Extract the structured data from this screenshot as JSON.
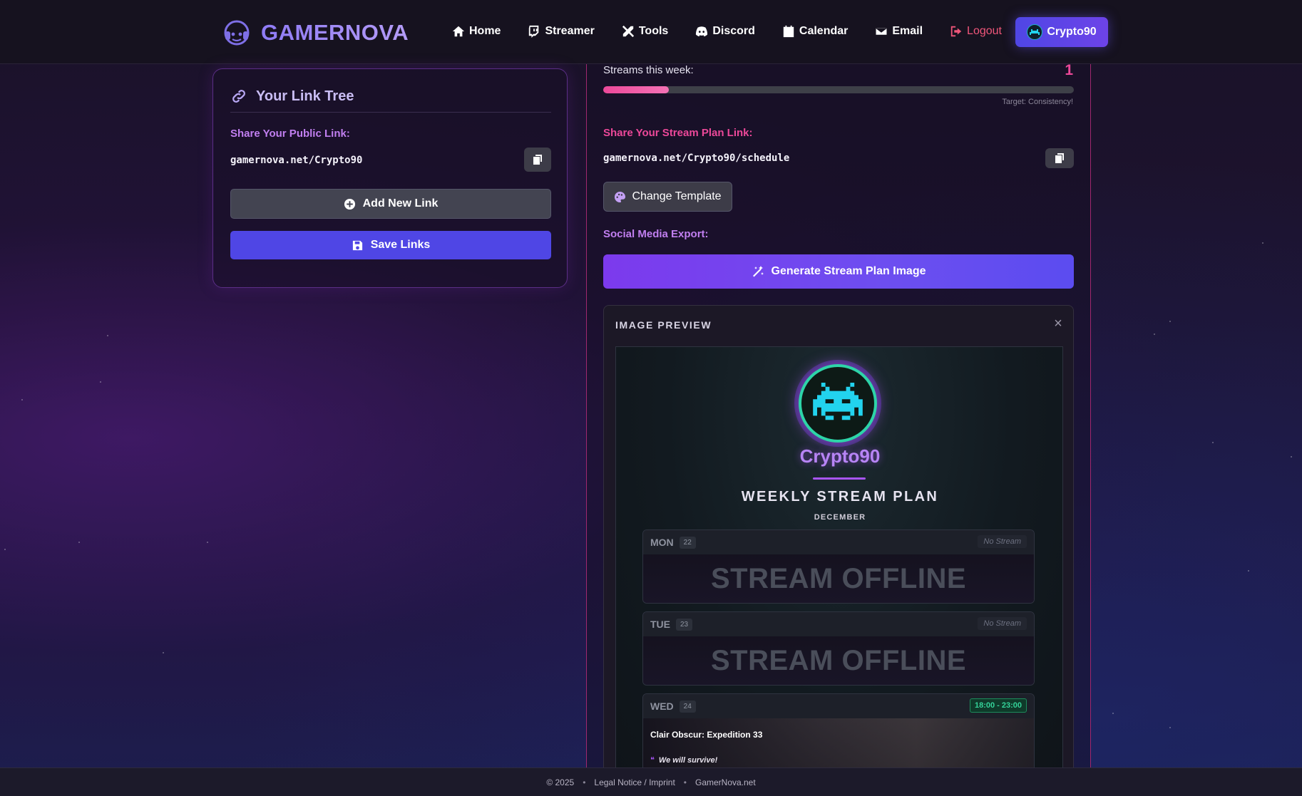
{
  "brand": {
    "name": "GAMERNOVA"
  },
  "nav": {
    "items": [
      {
        "label": "Home",
        "icon": "home-icon"
      },
      {
        "label": "Streamer",
        "icon": "twitch-icon"
      },
      {
        "label": "Tools",
        "icon": "tools-icon"
      },
      {
        "label": "Discord",
        "icon": "discord-icon"
      },
      {
        "label": "Calendar",
        "icon": "calendar-icon"
      },
      {
        "label": "Email",
        "icon": "envelope-icon"
      },
      {
        "label": "Logout",
        "icon": "logout-icon"
      }
    ],
    "user_label": "Crypto90"
  },
  "link_tree": {
    "title": "Your Link Tree",
    "public_link_label": "Share Your Public Link:",
    "public_link": "gamernova.net/Crypto90",
    "add_link_label": "Add New Link",
    "save_links_label": "Save Links"
  },
  "stream_panel": {
    "streams_label": "Streams this week:",
    "streams_count": "1",
    "progress_fraction": 0.14,
    "target_text": "Target: Consistency!",
    "plan_link_label": "Share Your Stream Plan Link:",
    "plan_link": "gamernova.net/Crypto90/schedule",
    "change_template_label": "Change Template",
    "social_export_label": "Social Media Export:",
    "generate_label": "Generate Stream Plan Image"
  },
  "preview": {
    "heading": "IMAGE PREVIEW",
    "close_symbol": "×",
    "plan": {
      "name": "Crypto90",
      "title": "WEEKLY STREAM PLAN",
      "month": "DECEMBER",
      "days": [
        {
          "day": "MON",
          "date": "22",
          "status": "No Stream",
          "offline_text": "STREAM OFFLINE"
        },
        {
          "day": "TUE",
          "date": "23",
          "status": "No Stream",
          "offline_text": "STREAM OFFLINE"
        },
        {
          "day": "WED",
          "date": "24",
          "time": "18:00 - 23:00",
          "game": "Clair Obscur: Expedition 33",
          "quote_mark": "❝",
          "quote": "We will survive!"
        }
      ]
    }
  },
  "footer": {
    "copyright": "© 2025",
    "separator": "•",
    "legal": "Legal Notice / Imprint",
    "site": "GamerNova.net"
  },
  "colors": {
    "accent_purple": "#7c3aed",
    "accent_indigo": "#4f46e5",
    "accent_pink": "#ec4899",
    "logout_red": "#f0567a"
  }
}
